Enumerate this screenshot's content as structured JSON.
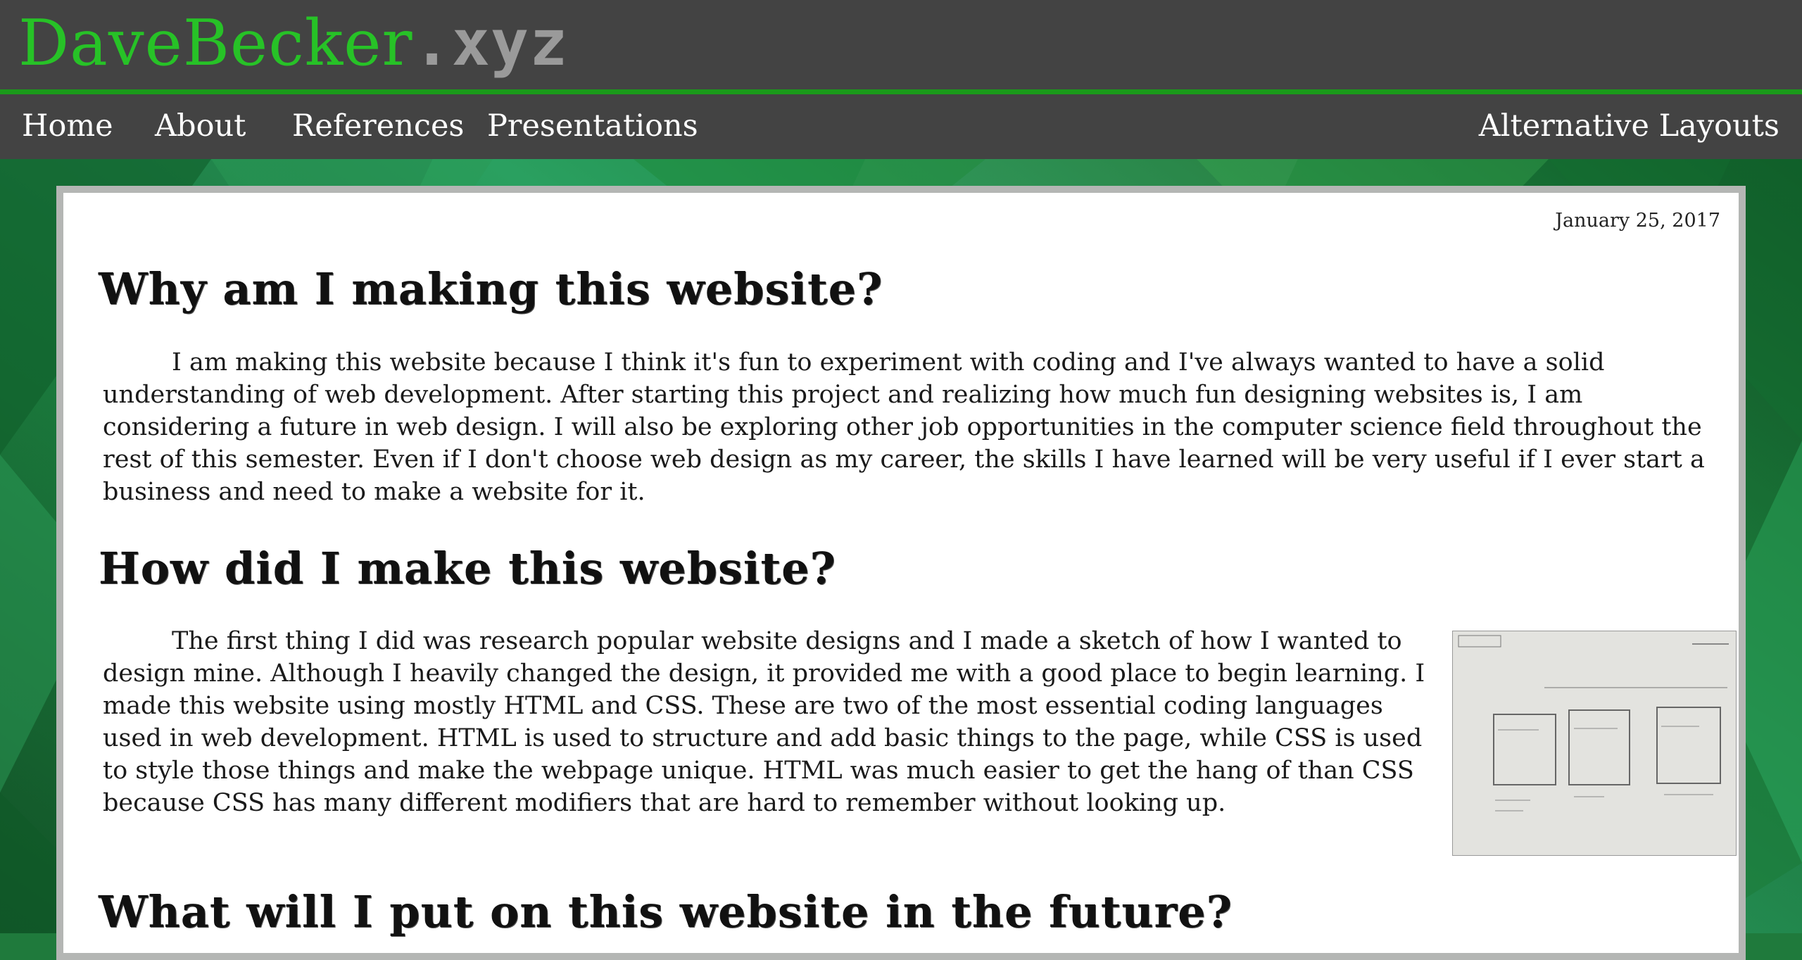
{
  "brand": {
    "name": "DaveBecker",
    "tld": ".xyz"
  },
  "nav": {
    "items": [
      "Home",
      "About",
      "References",
      "Presentations"
    ],
    "alternative": "Alternative Layouts"
  },
  "article": {
    "date": "January 25, 2017",
    "sections": [
      {
        "heading": "Why am I making this website?",
        "text": "I am making this website because I think it's fun to experiment with coding and I've always wanted to have a solid understanding of web development. After starting this project and realizing how much fun designing websites is, I am considering a future in web design. I will also be exploring other job opportunities in the computer science field throughout the rest of this semester. Even if I don't choose web design as my career, the skills I have learned will be very useful if I ever start a business and need to make a website for it."
      },
      {
        "heading": "How did I make this website?",
        "text": "The first thing I did was research popular website designs and I made a sketch of how I wanted to design mine. Although I heavily changed the design, it provided me with a good place to begin learning. I made this website using mostly HTML and CSS. These are two of the most essential coding languages used in web development. HTML is used to structure and add basic things to the page, while CSS is used to style those things and make the webpage unique. HTML was much easier to get the hang of than CSS because CSS has many different modifiers that are hard to remember without looking up."
      },
      {
        "heading": "What will I put on this website in the future?"
      }
    ]
  },
  "colors": {
    "accent": "#27c227",
    "bar": "#434343",
    "tld": "#9a9a9a"
  }
}
